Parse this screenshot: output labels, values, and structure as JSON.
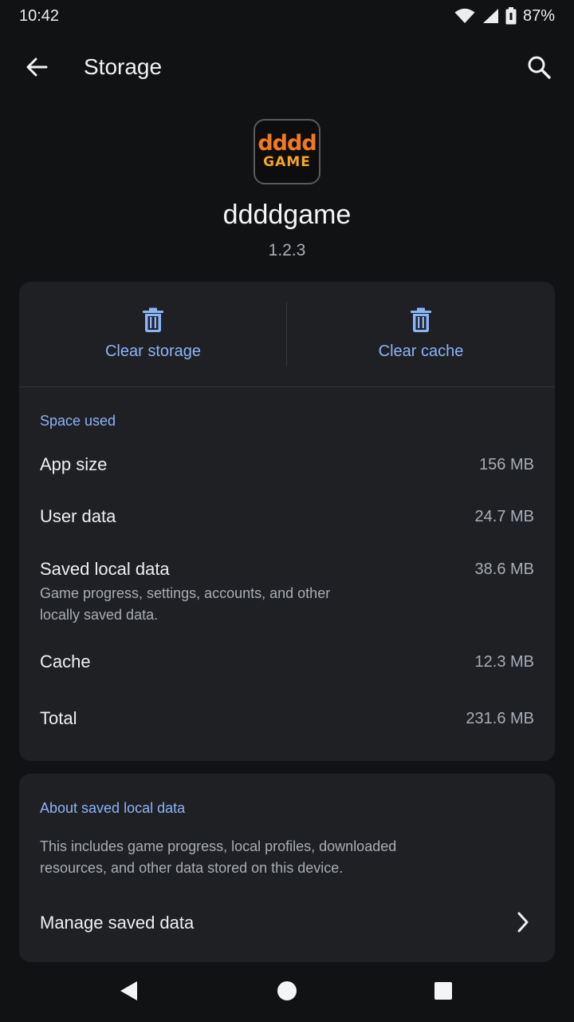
{
  "status_bar": {
    "time": "10:42",
    "battery_percent": "87%",
    "icons": [
      "wifi-icon",
      "cellular-signal-icon",
      "battery-icon"
    ]
  },
  "app_bar": {
    "title": "Storage",
    "back_icon": "arrow-back-icon",
    "search_icon": "search-icon"
  },
  "app": {
    "logo_top": "dddd",
    "logo_bottom": "GAME",
    "name": "ddddgame",
    "version": "1.2.3"
  },
  "actions": {
    "clear_storage": "Clear storage",
    "clear_cache": "Clear cache",
    "icon": "trash-icon"
  },
  "space_used": {
    "section_label": "Space used",
    "rows": [
      {
        "label": "App size",
        "value": "156 MB"
      },
      {
        "label": "User data",
        "value": "24.7 MB"
      },
      {
        "label": "Saved local data",
        "value": "38.6 MB",
        "sub": "Game progress, settings, accounts, and other locally saved data."
      },
      {
        "label": "Cache",
        "value": "12.3 MB"
      },
      {
        "label": "Total",
        "value": "231.6 MB"
      }
    ]
  },
  "about": {
    "section_label": "About saved local data",
    "description": "This includes game progress, local profiles, downloaded resources, and other data stored on this device.",
    "manage_label": "Manage saved data",
    "chevron_icon": "chevron-right-icon"
  },
  "nav_bar": {
    "icons": [
      "nav-back-icon",
      "nav-home-icon",
      "nav-recents-icon"
    ]
  },
  "colors": {
    "background": "#111214",
    "card": "#1F2024",
    "accent": "#8AB4F8",
    "text_primary": "#EEEFF1",
    "text_secondary": "#A9ADB4",
    "logo_orange": "#F07A1C"
  }
}
